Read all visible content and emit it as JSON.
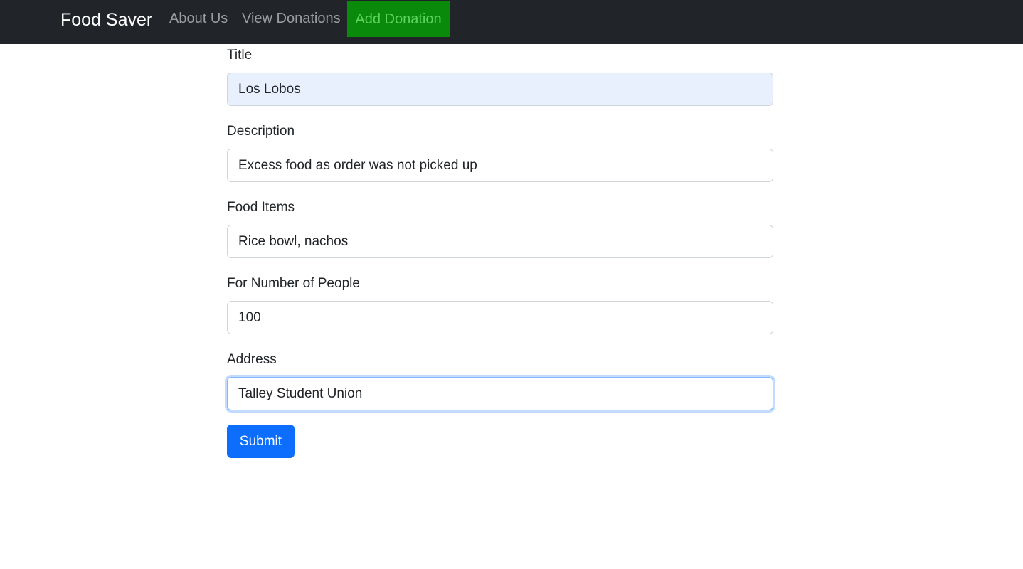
{
  "navbar": {
    "brand": "Food Saver",
    "links": [
      {
        "label": "About Us"
      },
      {
        "label": "View Donations"
      },
      {
        "label": "Add Donation"
      }
    ]
  },
  "form": {
    "title": {
      "label": "Title",
      "value": "Los Lobos"
    },
    "description": {
      "label": "Description",
      "value": "Excess food as order was not picked up"
    },
    "food_items": {
      "label": "Food Items",
      "value": "Rice bowl, nachos"
    },
    "people": {
      "label": "For Number of People",
      "value": "100"
    },
    "address": {
      "label": "Address",
      "value": "Talley Student Union"
    },
    "submit_label": "Submit"
  },
  "colors": {
    "navbar_bg": "#212529",
    "active_nav_bg": "#0a8a0a",
    "primary_button": "#0d6efd"
  }
}
